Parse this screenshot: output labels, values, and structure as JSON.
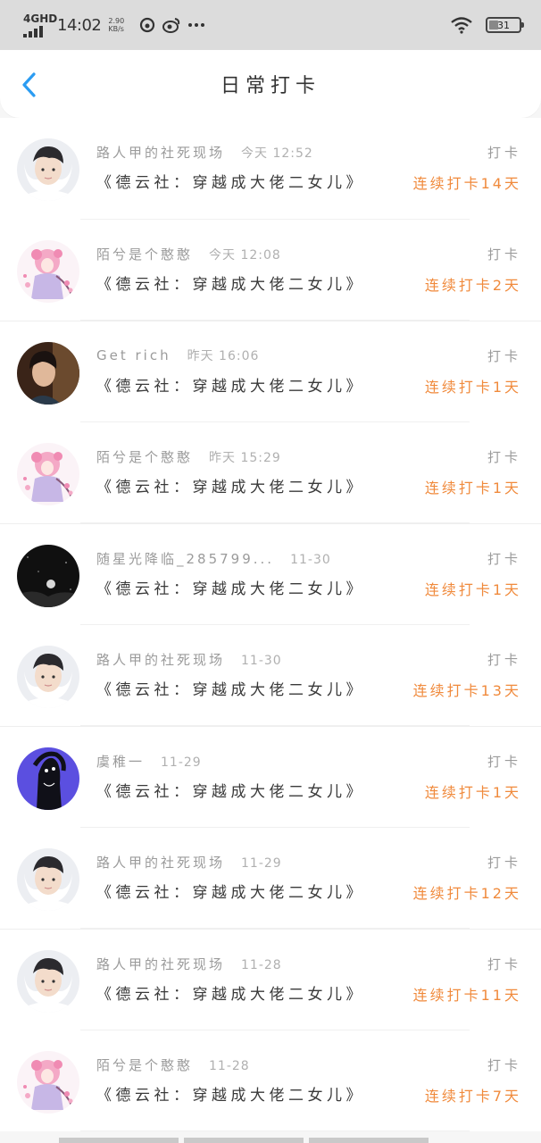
{
  "status_bar": {
    "network": "4GHD",
    "time": "14:02",
    "speed_value": "2.90",
    "speed_unit": "KB/s",
    "battery": "31",
    "battery_level": 0.31
  },
  "header": {
    "title": "日常打卡"
  },
  "items": [
    {
      "name": "路人甲的社死现场",
      "time": "今天 12:52",
      "book": "《德云社：穿越成大佬二女儿》",
      "action": "打卡",
      "streak": "连续打卡14天",
      "avatar": "boy"
    },
    {
      "name": "陌兮是个憨憨",
      "time": "今天 12:08",
      "book": "《德云社：穿越成大佬二女儿》",
      "action": "打卡",
      "streak": "连续打卡2天",
      "avatar": "pink"
    },
    {
      "name": "Get rich",
      "time": "昨天 16:06",
      "book": "《德云社：穿越成大佬二女儿》",
      "action": "打卡",
      "streak": "连续打卡1天",
      "avatar": "dark"
    },
    {
      "name": "陌兮是个憨憨",
      "time": "昨天 15:29",
      "book": "《德云社：穿越成大佬二女儿》",
      "action": "打卡",
      "streak": "连续打卡1天",
      "avatar": "pink"
    },
    {
      "name": "随星光降临_285799...",
      "time": "11-30",
      "book": "《德云社：穿越成大佬二女儿》",
      "action": "打卡",
      "streak": "连续打卡1天",
      "avatar": "night"
    },
    {
      "name": "路人甲的社死现场",
      "time": "11-30",
      "book": "《德云社：穿越成大佬二女儿》",
      "action": "打卡",
      "streak": "连续打卡13天",
      "avatar": "boy"
    },
    {
      "name": "虞稚一",
      "time": "11-29",
      "book": "《德云社：穿越成大佬二女儿》",
      "action": "打卡",
      "streak": "连续打卡1天",
      "avatar": "purple"
    },
    {
      "name": "路人甲的社死现场",
      "time": "11-29",
      "book": "《德云社：穿越成大佬二女儿》",
      "action": "打卡",
      "streak": "连续打卡12天",
      "avatar": "boy"
    },
    {
      "name": "路人甲的社死现场",
      "time": "11-28",
      "book": "《德云社：穿越成大佬二女儿》",
      "action": "打卡",
      "streak": "连续打卡11天",
      "avatar": "boy"
    },
    {
      "name": "陌兮是个憨憨",
      "time": "11-28",
      "book": "《德云社：穿越成大佬二女儿》",
      "action": "打卡",
      "streak": "连续打卡7天",
      "avatar": "pink"
    }
  ],
  "colors": {
    "accent": "#f08a3c",
    "back_arrow": "#2b9cf2",
    "status_bar_bg": "#dcdcdc"
  }
}
